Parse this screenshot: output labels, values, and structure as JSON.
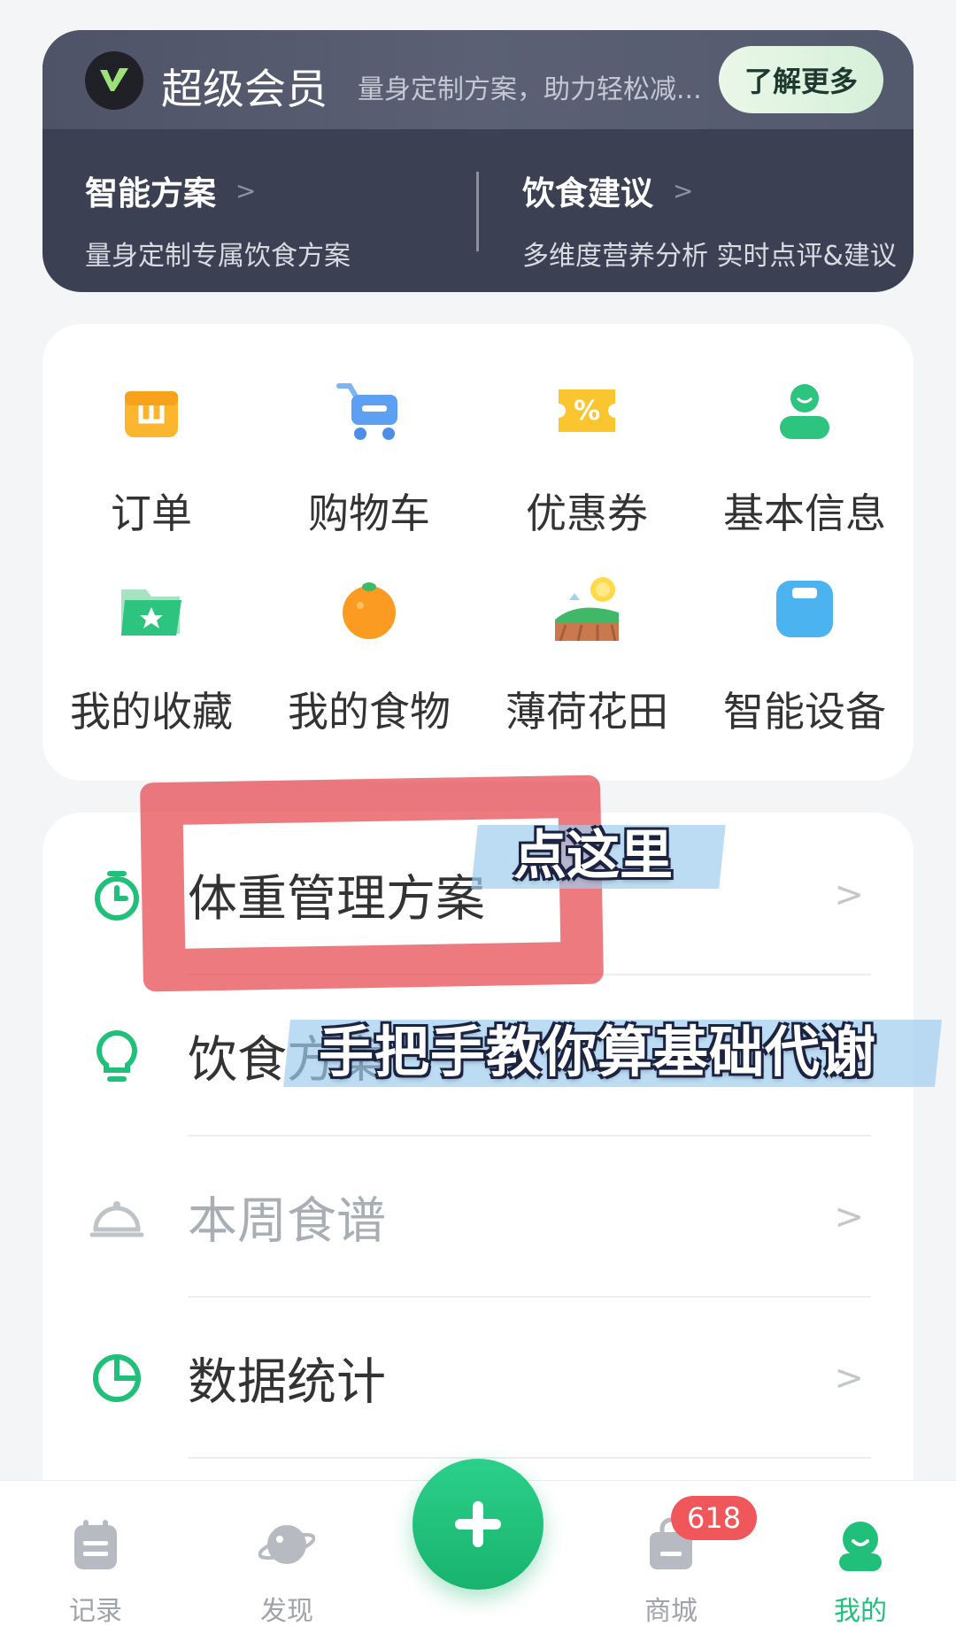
{
  "vip": {
    "title": "超级会员",
    "slogan": "量身定制方案，助力轻松减...",
    "learn_more": "了解更多",
    "features": [
      {
        "title": "智能方案",
        "subtitle": "量身定制专属饮食方案"
      },
      {
        "title": "饮食建议",
        "subtitle": "多维度营养分析 实时点评&建议"
      }
    ]
  },
  "tools": [
    {
      "label": "订单",
      "icon": "order-box-icon"
    },
    {
      "label": "购物车",
      "icon": "cart-icon"
    },
    {
      "label": "优惠券",
      "icon": "coupon-icon"
    },
    {
      "label": "基本信息",
      "icon": "profile-icon"
    },
    {
      "label": "我的收藏",
      "icon": "favorites-folder-icon"
    },
    {
      "label": "我的食物",
      "icon": "orange-icon"
    },
    {
      "label": "薄荷花田",
      "icon": "flower-field-icon"
    },
    {
      "label": "智能设备",
      "icon": "scale-device-icon"
    }
  ],
  "menu": [
    {
      "label": "体重管理方案",
      "icon": "timer-icon"
    },
    {
      "label": "饮食方案",
      "icon": "bulb-icon"
    },
    {
      "label": "本周食谱",
      "icon": "cloche-icon"
    },
    {
      "label": "数据统计",
      "icon": "pie-chart-icon"
    }
  ],
  "annotations": {
    "tap_here": "点这里",
    "guide": "手把手教你算基础代谢"
  },
  "tabbar": {
    "tabs": [
      {
        "label": "记录",
        "icon": "record-icon"
      },
      {
        "label": "发现",
        "icon": "planet-icon"
      },
      {
        "label": "商城",
        "icon": "shop-bag-icon"
      },
      {
        "label": "我的",
        "icon": "me-icon"
      }
    ],
    "badge": "618",
    "add_icon": "plus-icon"
  },
  "colors": {
    "brand_green": "#20c07a",
    "vip_bg": "#3b4052",
    "badge_red": "#f0575b",
    "highlight_red": "#e6464e"
  }
}
